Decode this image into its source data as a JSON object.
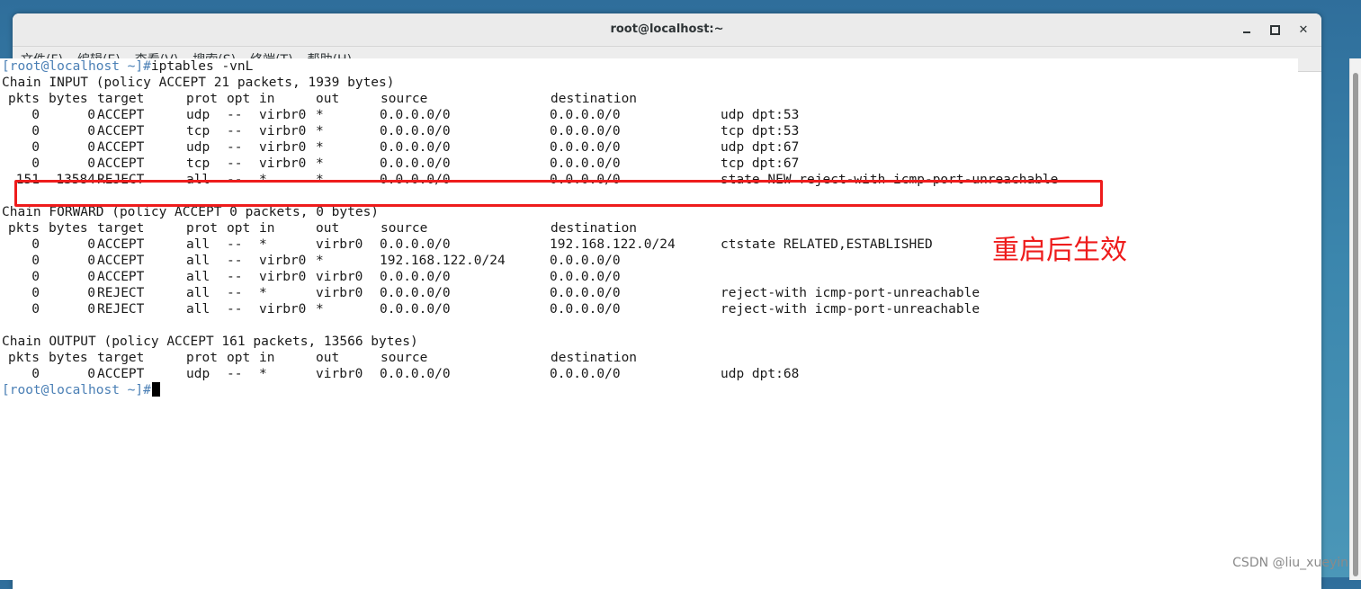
{
  "desktop": {
    "edge_label": ".6"
  },
  "window": {
    "title": "root@localhost:~"
  },
  "menu": [
    {
      "label": "文件(F)"
    },
    {
      "label": "编辑(E)"
    },
    {
      "label": "查看(V)"
    },
    {
      "label": "搜索(S)"
    },
    {
      "label": "终端(T)"
    },
    {
      "label": "帮助(H)"
    }
  ],
  "prompt": "[root@localhost ~]#",
  "command": "iptables -vnL",
  "chains": [
    {
      "header": "Chain INPUT (policy ACCEPT 21 packets, 1939 bytes)",
      "rows": [
        {
          "pkts": "0",
          "bytes": "0",
          "target": "ACCEPT",
          "prot": "udp",
          "opt": "--",
          "in": "virbr0",
          "out": "*",
          "source": "0.0.0.0/0",
          "destination": "0.0.0.0/0",
          "extra": "udp dpt:53"
        },
        {
          "pkts": "0",
          "bytes": "0",
          "target": "ACCEPT",
          "prot": "tcp",
          "opt": "--",
          "in": "virbr0",
          "out": "*",
          "source": "0.0.0.0/0",
          "destination": "0.0.0.0/0",
          "extra": "tcp dpt:53"
        },
        {
          "pkts": "0",
          "bytes": "0",
          "target": "ACCEPT",
          "prot": "udp",
          "opt": "--",
          "in": "virbr0",
          "out": "*",
          "source": "0.0.0.0/0",
          "destination": "0.0.0.0/0",
          "extra": "udp dpt:67"
        },
        {
          "pkts": "0",
          "bytes": "0",
          "target": "ACCEPT",
          "prot": "tcp",
          "opt": "--",
          "in": "virbr0",
          "out": "*",
          "source": "0.0.0.0/0",
          "destination": "0.0.0.0/0",
          "extra": "tcp dpt:67"
        },
        {
          "pkts": "151",
          "bytes": "13584",
          "target": "REJECT",
          "prot": "all",
          "opt": "--",
          "in": "*",
          "out": "*",
          "source": "0.0.0.0/0",
          "destination": "0.0.0.0/0",
          "extra": "state NEW reject-with icmp-port-unreachable"
        }
      ]
    },
    {
      "header": "Chain FORWARD (policy ACCEPT 0 packets, 0 bytes)",
      "rows": [
        {
          "pkts": "0",
          "bytes": "0",
          "target": "ACCEPT",
          "prot": "all",
          "opt": "--",
          "in": "*",
          "out": "virbr0",
          "source": "0.0.0.0/0",
          "destination": "192.168.122.0/24",
          "extra": "ctstate RELATED,ESTABLISHED"
        },
        {
          "pkts": "0",
          "bytes": "0",
          "target": "ACCEPT",
          "prot": "all",
          "opt": "--",
          "in": "virbr0",
          "out": "*",
          "source": "192.168.122.0/24",
          "destination": "0.0.0.0/0",
          "extra": ""
        },
        {
          "pkts": "0",
          "bytes": "0",
          "target": "ACCEPT",
          "prot": "all",
          "opt": "--",
          "in": "virbr0",
          "out": "virbr0",
          "source": "0.0.0.0/0",
          "destination": "0.0.0.0/0",
          "extra": ""
        },
        {
          "pkts": "0",
          "bytes": "0",
          "target": "REJECT",
          "prot": "all",
          "opt": "--",
          "in": "*",
          "out": "virbr0",
          "source": "0.0.0.0/0",
          "destination": "0.0.0.0/0",
          "extra": "reject-with icmp-port-unreachable"
        },
        {
          "pkts": "0",
          "bytes": "0",
          "target": "REJECT",
          "prot": "all",
          "opt": "--",
          "in": "virbr0",
          "out": "*",
          "source": "0.0.0.0/0",
          "destination": "0.0.0.0/0",
          "extra": "reject-with icmp-port-unreachable"
        }
      ]
    },
    {
      "header": "Chain OUTPUT (policy ACCEPT 161 packets, 13566 bytes)",
      "rows": [
        {
          "pkts": "0",
          "bytes": "0",
          "target": "ACCEPT",
          "prot": "udp",
          "opt": "--",
          "in": "*",
          "out": "virbr0",
          "source": "0.0.0.0/0",
          "destination": "0.0.0.0/0",
          "extra": "udp dpt:68"
        }
      ]
    }
  ],
  "column_headers": {
    "pkts": "pkts",
    "bytes": "bytes",
    "target": "target",
    "prot": "prot",
    "opt": "opt",
    "in": "in",
    "out": "out",
    "source": "source",
    "destination": "destination"
  },
  "annotation": {
    "text": "重启后生效",
    "color": "#ee1c1c"
  },
  "watermark": "CSDN @liu_xueyin"
}
